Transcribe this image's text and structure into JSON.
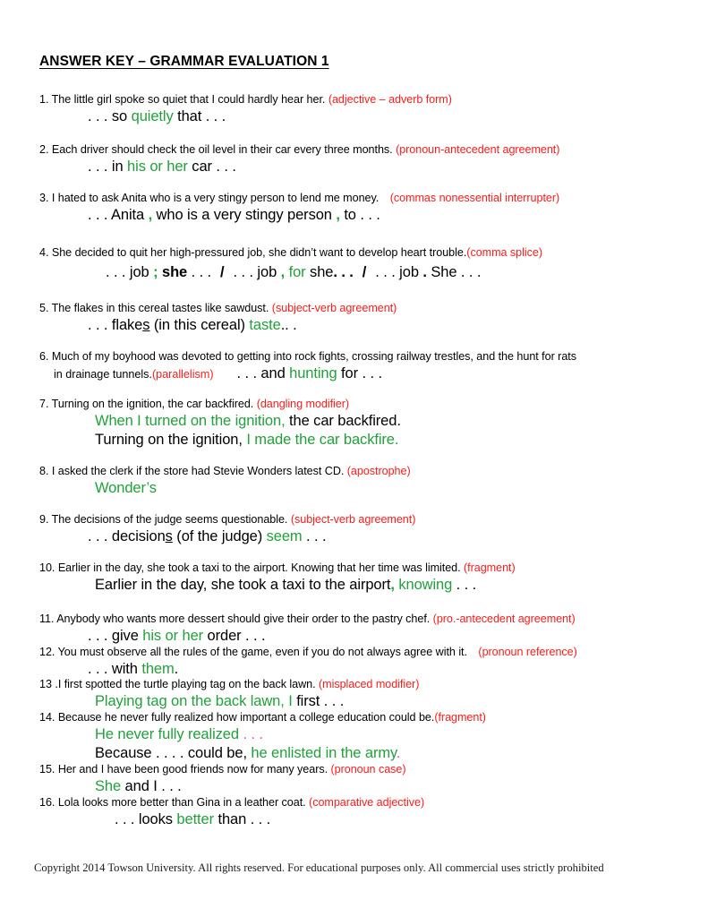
{
  "document": {
    "title": "ANSWER KEY – GRAMMAR EVALUATION 1",
    "footer": "Copyright 2014 Towson University.  All rights reserved.  For educational purposes only.  All commercial uses strictly prohibited"
  },
  "colors": {
    "annotation_red": "#ff1a1a",
    "correction_green": "#22a03c",
    "correction_green_alt": "#3aa06a",
    "magenta": "#e24ad0",
    "text_black": "#000000"
  },
  "items": [
    {
      "number": "1.",
      "prompt": "The little girl spoke so quiet that I could hardly hear her.",
      "annotation": "(adjective – adverb form)",
      "answer_parts": [
        {
          "t": ". . . so ",
          "c": "black"
        },
        {
          "t": "quietly",
          "c": "green"
        },
        {
          "t": " that . . .",
          "c": "black"
        }
      ]
    },
    {
      "number": "2.",
      "prompt": "Each driver should check the oil level in their car every three months.",
      "annotation": "(pronoun-antecedent agreement)",
      "answer_parts": [
        {
          "t": ". . . in  ",
          "c": "black"
        },
        {
          "t": "his or her",
          "c": "green"
        },
        {
          "t": " car . . .",
          "c": "black"
        }
      ]
    },
    {
      "number": "3.",
      "prompt": "I hated to ask Anita who is a very stingy person to lend me money.",
      "annotation": "(commas nonessential interrupter)",
      "answer_parts": [
        {
          "t": ". . . Anita ",
          "c": "black"
        },
        {
          "t": ",",
          "c": "green-bold"
        },
        {
          "t": " who is a very stingy person ",
          "c": "black"
        },
        {
          "t": ",",
          "c": "green-bold"
        },
        {
          "t": " to . . .",
          "c": "black"
        }
      ]
    },
    {
      "number": "4.",
      "prompt": "She decided to quit her high-pressured job, she didn’t want to develop heart trouble.",
      "annotation": "(comma splice)",
      "answer_parts": [
        {
          "t": ". . . job ",
          "c": "black"
        },
        {
          "t": ";",
          "c": "green-bold"
        },
        {
          "t": " she",
          "c": "black-bold"
        },
        {
          "t": " . . .",
          "c": "black"
        },
        {
          "t": "/",
          "c": "slash"
        },
        {
          "t": ". . . job ",
          "c": "black"
        },
        {
          "t": ",",
          "c": "green-bold"
        },
        {
          "t": " for",
          "c": "green"
        },
        {
          "t": " she",
          "c": "black"
        },
        {
          "t": ". . .",
          "c": "black-bold"
        },
        {
          "t": "/",
          "c": "slash"
        },
        {
          "t": ". . . job ",
          "c": "black"
        },
        {
          "t": ".",
          "c": "black-bold"
        },
        {
          "t": " She . . .",
          "c": "black"
        }
      ]
    },
    {
      "number": "5.",
      "prompt": "The flakes in this cereal tastes like sawdust.",
      "annotation": "(subject-verb agreement)",
      "answer_parts": [
        {
          "t": ". . . flake",
          "c": "black"
        },
        {
          "t": "s",
          "c": "black-underline"
        },
        {
          "t": " (in this cereal) ",
          "c": "black"
        },
        {
          "t": "taste",
          "c": "green"
        },
        {
          "t": ".. .",
          "c": "black"
        }
      ]
    },
    {
      "number": "6.",
      "prompt": "Much of my boyhood was devoted to getting into rock fights, crossing railway trestles, and the hunt for rats",
      "prompt_cont": "in drainage tunnels.",
      "annotation": "(parallelism)",
      "answer_parts": [
        {
          "t": ". . . and ",
          "c": "black"
        },
        {
          "t": "hunting",
          "c": "green"
        },
        {
          "t": " for . . .",
          "c": "black"
        }
      ]
    },
    {
      "number": "7.",
      "prompt": "Turning on the ignition, the car backfired.",
      "annotation": "(dangling modifier)",
      "answer_parts": [
        {
          "t": "When I turned on the ignition,",
          "c": "green"
        },
        {
          "t": " the car backfired.",
          "c": "black"
        }
      ],
      "answer2_parts": [
        {
          "t": "Turning on the ignition, ",
          "c": "black"
        },
        {
          "t": "I made the car backfire.",
          "c": "green"
        }
      ]
    },
    {
      "number": "8.",
      "prompt": "I asked the clerk if the store had Stevie Wonders latest CD.",
      "annotation": "(apostrophe)",
      "answer_parts": [
        {
          "t": "Wonder’s",
          "c": "green"
        }
      ]
    },
    {
      "number": "9.",
      "prompt": "The decisions of the judge seems questionable.",
      "annotation": "(subject-verb agreement)",
      "answer_parts": [
        {
          "t": ". . . decision",
          "c": "black"
        },
        {
          "t": "s",
          "c": "black-underline"
        },
        {
          "t": " (of the judge) ",
          "c": "black"
        },
        {
          "t": "seem",
          "c": "green"
        },
        {
          "t": " . . .",
          "c": "black"
        }
      ]
    },
    {
      "number": "10.",
      "prompt": "Earlier in the day, she took a taxi to the airport.  Knowing that her time was limited.",
      "annotation": "(fragment)",
      "answer_parts": [
        {
          "t": "Earlier in the day, she took a taxi to the airport",
          "c": "black"
        },
        {
          "t": ",",
          "c": "green-bold"
        },
        {
          "t": " knowing",
          "c": "green"
        },
        {
          "t": " . . .",
          "c": "black"
        }
      ]
    },
    {
      "number": "11.",
      "prompt": "Anybody who wants more dessert should give their order to the pastry chef.",
      "annotation": "(pro.-antecedent agreement)",
      "answer_parts": [
        {
          "t": ". . . give ",
          "c": "black"
        },
        {
          "t": "his or her",
          "c": "green"
        },
        {
          "t": " order . . .",
          "c": "black"
        }
      ]
    },
    {
      "number": "12.",
      "prompt": "You must observe all the rules of the game, even if you do not always agree with it.",
      "annotation": "(pronoun reference)",
      "answer_parts": [
        {
          "t": ". . . with ",
          "c": "black"
        },
        {
          "t": "them",
          "c": "green"
        },
        {
          "t": ".",
          "c": "black"
        }
      ]
    },
    {
      "number": "13 .",
      "prompt": "I first spotted the turtle playing tag on the back lawn.",
      "annotation": "(misplaced modifier)",
      "answer_parts": [
        {
          "t": "Playing tag on the back lawn, I",
          "c": "green"
        },
        {
          "t": " first . . .",
          "c": "black"
        }
      ]
    },
    {
      "number": "14.",
      "prompt": "Because he never fully realized how important a college education could be.",
      "annotation": "(fragment)",
      "answer_parts": [
        {
          "t": "He never fully realized ",
          "c": "green"
        },
        {
          "t": ". . .",
          "c": "magenta"
        }
      ],
      "answer2_parts": [
        {
          "t": "Because . . . . could be, ",
          "c": "black"
        },
        {
          "t": "he enlisted in the army",
          "c": "green"
        },
        {
          "t": ".",
          "c": "magenta"
        }
      ]
    },
    {
      "number": "15.",
      "prompt": "Her and I have been good friends now for many years.",
      "annotation": "(pronoun case)",
      "answer_parts": [
        {
          "t": "She",
          "c": "green"
        },
        {
          "t": " and I . . .",
          "c": "black"
        }
      ]
    },
    {
      "number": "16.",
      "prompt": "Lola looks more better than Gina in a leather coat.",
      "annotation": "(comparative adjective)",
      "answer_parts": [
        {
          "t": ". . . looks ",
          "c": "black"
        },
        {
          "t": "better",
          "c": "green"
        },
        {
          "t": " than . . .",
          "c": "black"
        }
      ]
    }
  ]
}
